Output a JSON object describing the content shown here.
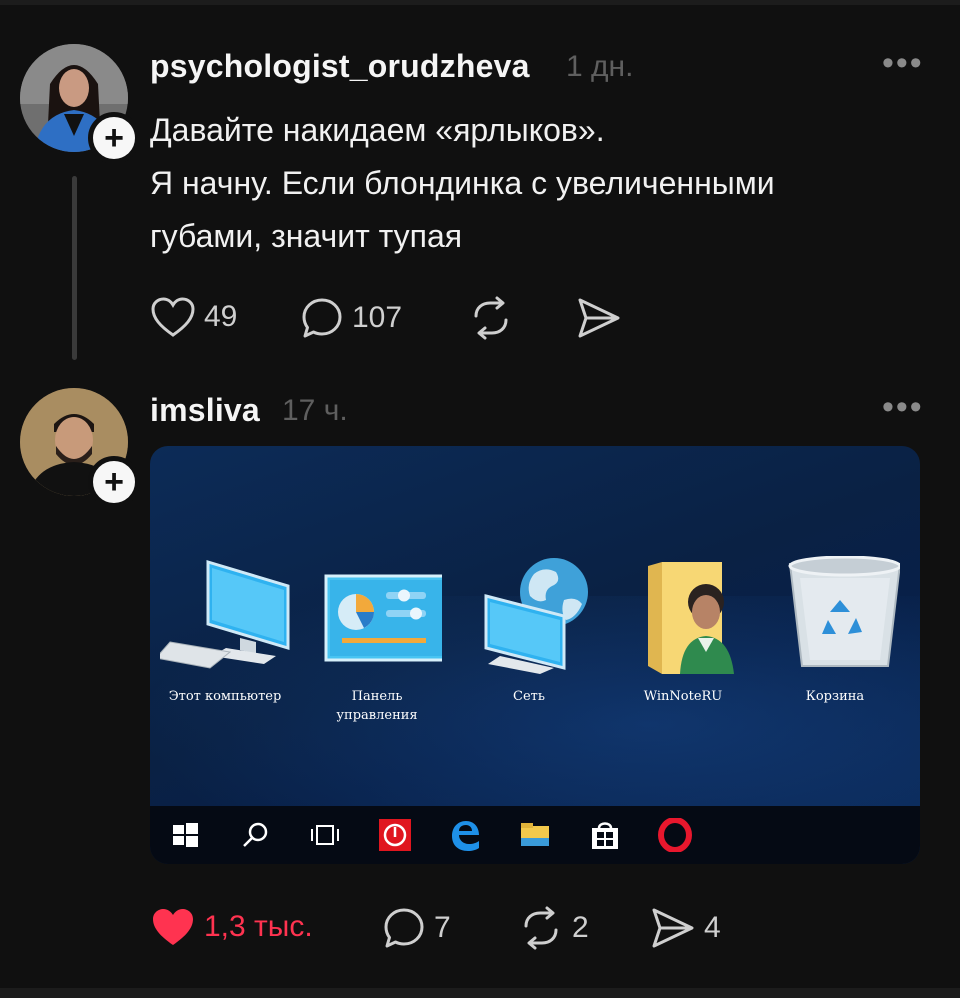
{
  "posts": [
    {
      "username": "psychologist_orudzheva",
      "time": "1 дн.",
      "more": "•••",
      "text_lines": [
        "Давайте накидаем «ярлыков».",
        "Я начну. Если блондинка с увеличенными",
        "губами, значит тупая"
      ],
      "likes": "49",
      "replies": "107"
    },
    {
      "username": "imsliva",
      "time": "17 ч.",
      "more": "•••",
      "likes": "1,3 тыс.",
      "replies": "7",
      "reposts": "2",
      "shares": "4",
      "media": {
        "desktop_icons": [
          {
            "label_lines": [
              "Этот компьютер"
            ],
            "icon": "computer-icon"
          },
          {
            "label_lines": [
              "Панель",
              "управления"
            ],
            "icon": "control-panel-icon"
          },
          {
            "label_lines": [
              "Сеть"
            ],
            "icon": "network-icon"
          },
          {
            "label_lines": [
              "WinNoteRU"
            ],
            "icon": "user-folder-icon"
          },
          {
            "label_lines": [
              "Корзина"
            ],
            "icon": "recycle-bin-icon"
          }
        ],
        "taskbar_icons": [
          "windows-start-icon",
          "search-icon",
          "task-view-icon",
          "power-app-icon",
          "edge-icon",
          "file-explorer-icon",
          "store-icon",
          "opera-icon"
        ]
      }
    }
  ],
  "colors": {
    "background": "#101010",
    "liked": "#ff3350",
    "muted": "#5f5f5f"
  }
}
